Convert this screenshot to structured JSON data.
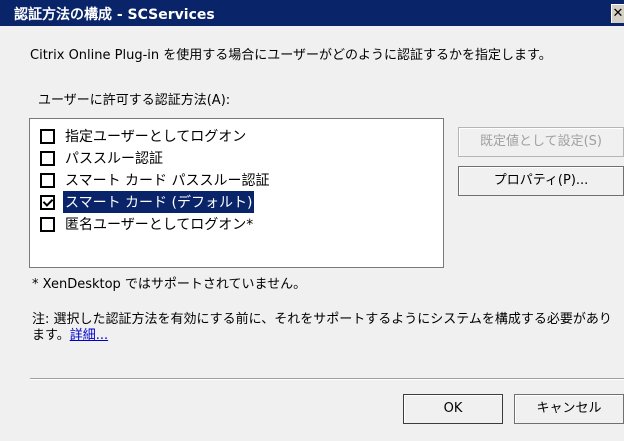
{
  "window": {
    "title": "認証方法の構成 - SCServices",
    "close_glyph": "✕"
  },
  "description": "Citrix Online Plug-in を使用する場合にユーザーがどのように認証するかを指定します。",
  "list_label": "ユーザーに許可する認証方法(A):",
  "auth_methods": [
    {
      "label": "指定ユーザーとしてログオン",
      "checked": false,
      "selected": false
    },
    {
      "label": "パススルー認証",
      "checked": false,
      "selected": false
    },
    {
      "label": "スマート カード パススルー認証",
      "checked": false,
      "selected": false
    },
    {
      "label": "スマート カード (デフォルト)",
      "checked": true,
      "selected": true
    },
    {
      "label": "匿名ユーザーとしてログオン*",
      "checked": false,
      "selected": false
    }
  ],
  "buttons": {
    "set_default": "既定値として設定(S)",
    "properties": "プロパティ(P)...",
    "ok": "OK",
    "cancel": "キャンセル"
  },
  "footnote": "* XenDesktop ではサポートされていません。",
  "note": {
    "text": "注: 選択した認証方法を有効にする前に、それをサポートするようにシステムを構成する必要があります。",
    "link": "詳細..."
  },
  "colors": {
    "titlebar": "#0a246a",
    "selection": "#0a246a",
    "link": "#0000cc"
  }
}
